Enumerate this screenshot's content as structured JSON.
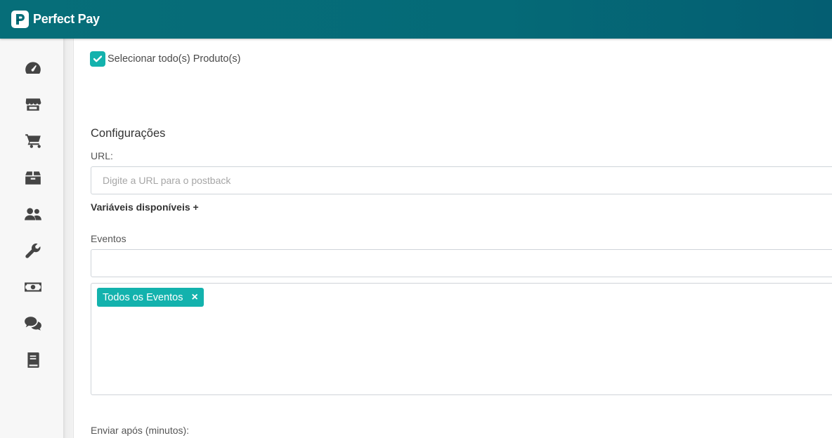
{
  "app": {
    "brand": "Perfect Pay"
  },
  "sidebar": {
    "items": [
      {
        "icon": "dashboard-icon"
      },
      {
        "icon": "store-icon"
      },
      {
        "icon": "cart-icon"
      },
      {
        "icon": "box-icon"
      },
      {
        "icon": "users-icon"
      },
      {
        "icon": "wrench-icon"
      },
      {
        "icon": "money-icon"
      },
      {
        "icon": "chat-icon"
      },
      {
        "icon": "book-icon"
      }
    ]
  },
  "form": {
    "select_all_label": "Selecionar todo(s) Produto(s)",
    "select_all_checked": true,
    "section_title": "Configurações",
    "url_label": "URL:",
    "url_placeholder": "Digite a URL para o postback",
    "url_value": "",
    "variables_link": "Variáveis disponíveis +",
    "events_label": "Eventos",
    "events_value": "",
    "selected_events": [
      {
        "label": "Todos os Eventos",
        "remove": "×"
      }
    ],
    "send_after_label": "Enviar após (minutos):"
  },
  "colors": {
    "topbar": "#066e79",
    "accent": "#13b2ad",
    "sidebar_bg": "#f7f7f7",
    "icon": "#454545"
  }
}
